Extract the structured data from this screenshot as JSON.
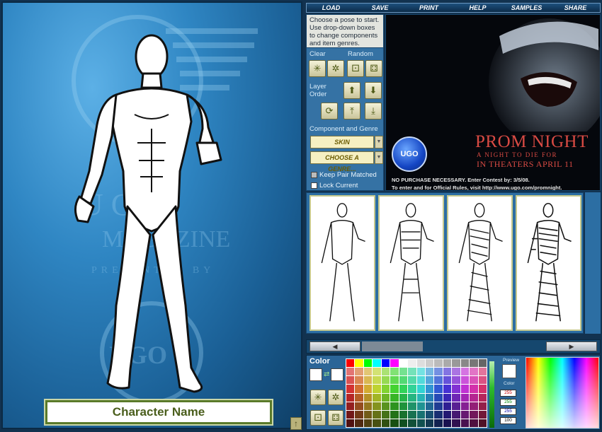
{
  "nav": {
    "items": [
      "LOAD",
      "SAVE",
      "PRINT",
      "HELP",
      "SAMPLES",
      "SHARE"
    ]
  },
  "stage": {
    "character_name": "Character Name",
    "up_arrow": "↑"
  },
  "controls": {
    "instructions": "Choose a pose to start. Use drop-down boxes to change components and item genres.",
    "clear_label": "Clear",
    "random_label": "Random",
    "layer_order_label": "Layer Order",
    "component_genre_label": "Component and Genre",
    "component_value": "SKIN",
    "genre_value": "CHOOSE A GENRE...",
    "keep_pair_label": "Keep Pair Matched",
    "lock_current_label": "Lock Current"
  },
  "ad": {
    "badge": "UGO",
    "title": "PROM NIGHT",
    "subtitle": "A NIGHT TO DIE FOR",
    "release": "IN THEATERS APRIL 11",
    "fine1": "NO PURCHASE NECESSARY.  Enter Contest by: 3/5/08.",
    "fine2_prefix": "To enter and for ",
    "fine2_rules": "Official Rules",
    "fine2_mid": ", visit ",
    "fine2_url": "http://www.ugo.com/promnight",
    "fine2_end": "."
  },
  "color": {
    "heading": "Color",
    "preview_label": "Preview",
    "color_label": "Color",
    "r": "255",
    "g": "255",
    "b": "255",
    "a": "100",
    "palette": [
      "#ff0000",
      "#ffff00",
      "#00ff00",
      "#00ffff",
      "#0000ff",
      "#ff00ff",
      "#ffffff",
      "#eeeeee",
      "#dddddd",
      "#cccccc",
      "#bbbbbb",
      "#aaaaaa",
      "#999999",
      "#888888",
      "#777777",
      "#666666"
    ]
  }
}
